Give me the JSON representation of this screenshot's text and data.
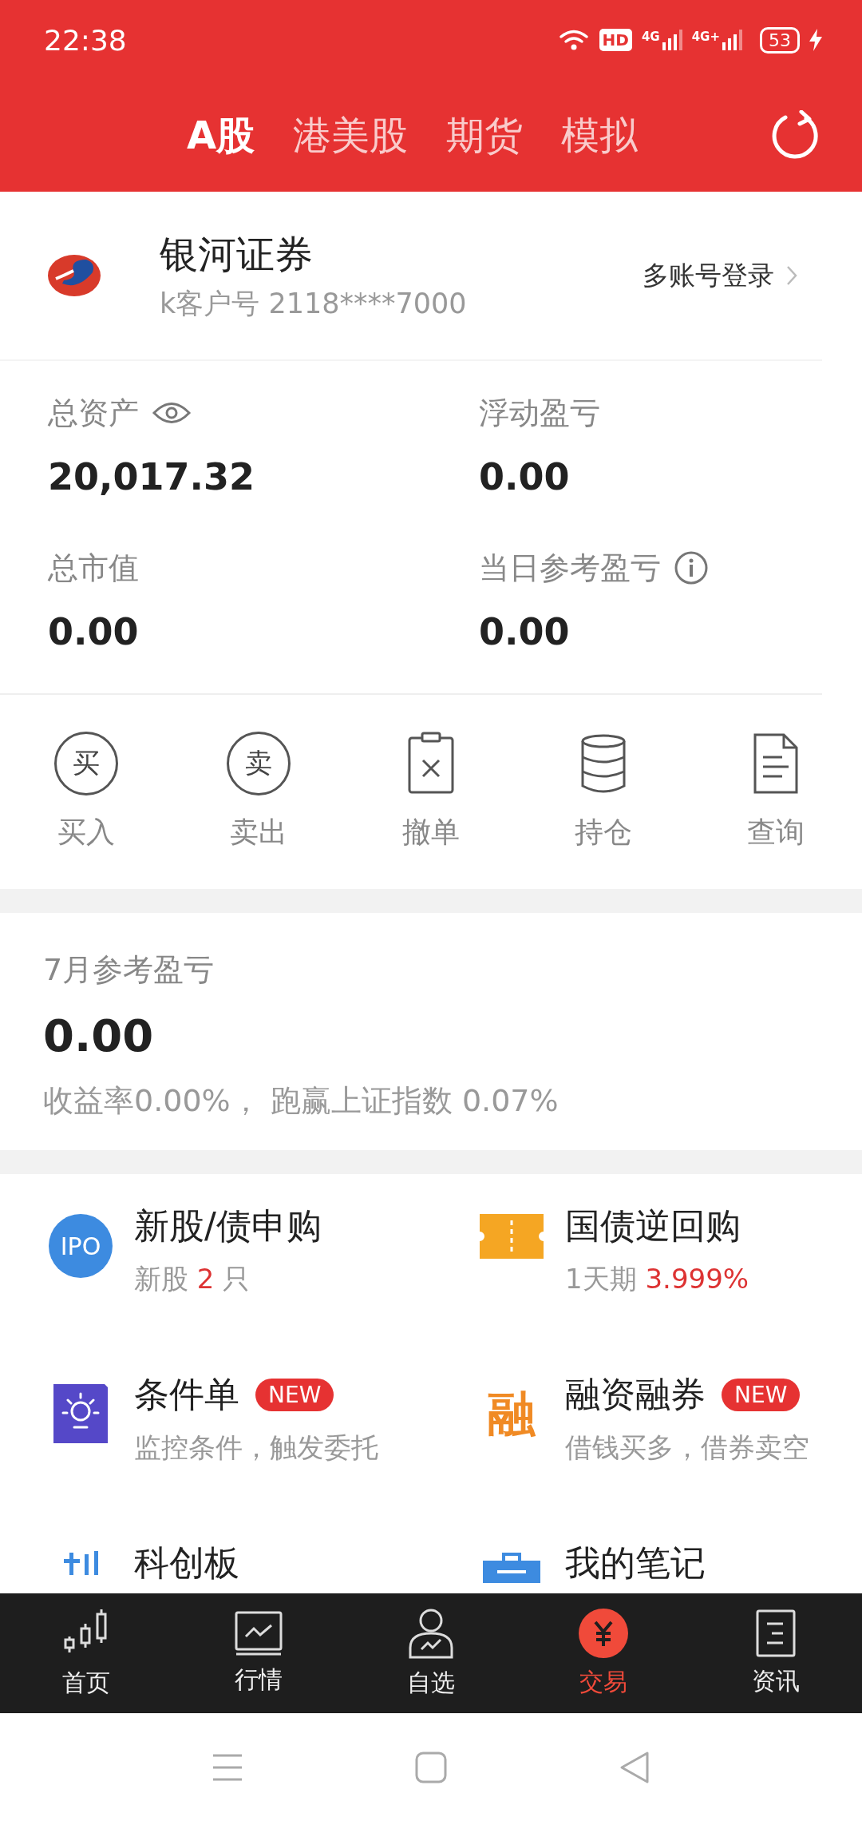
{
  "status_bar": {
    "time": "22:38",
    "hd": "HD",
    "networks": [
      "4G",
      "4G+"
    ],
    "battery": "53"
  },
  "tabs": [
    {
      "label": "A股",
      "selected": true
    },
    {
      "label": "港美股",
      "selected": false
    },
    {
      "label": "期货",
      "selected": false
    },
    {
      "label": "模拟",
      "selected": false
    }
  ],
  "account": {
    "broker": "银河证券",
    "customer_no": "k客户号 2118****7000",
    "multi_login": "多账号登录"
  },
  "assets": [
    {
      "label": "总资产",
      "value": "20,017.32",
      "kind": "eye"
    },
    {
      "label": "浮动盈亏",
      "value": "0.00",
      "kind": "plain"
    },
    {
      "label": "总市值",
      "value": "0.00",
      "kind": "plain"
    },
    {
      "label": "当日参考盈亏",
      "value": "0.00",
      "kind": "info"
    }
  ],
  "actions": [
    {
      "label": "买入",
      "glyph": "买"
    },
    {
      "label": "卖出",
      "glyph": "卖"
    },
    {
      "label": "撤单"
    },
    {
      "label": "持仓"
    },
    {
      "label": "查询"
    }
  ],
  "monthly": {
    "title": "7月参考盈亏",
    "value": "0.00",
    "summary": "收益率0.00%， 跑赢上证指数 0.07%"
  },
  "services": [
    {
      "title": "新股/债申购",
      "icon_text": "IPO",
      "subtitle": [
        {
          "text": "新股 ",
          "highlight": false
        },
        {
          "text": "2",
          "highlight": true
        },
        {
          "text": " 只",
          "highlight": false
        }
      ]
    },
    {
      "title": "国债逆回购",
      "subtitle": [
        {
          "text": "1天期 ",
          "highlight": false
        },
        {
          "text": "3.999%",
          "highlight": true
        }
      ]
    },
    {
      "title": "条件单",
      "badge": "NEW",
      "subtitle": [
        {
          "text": "监控条件，触发委托",
          "highlight": false
        }
      ]
    },
    {
      "title": "融资融券",
      "badge": "NEW",
      "icon_text": "融",
      "subtitle": [
        {
          "text": "借钱买多，借券卖空",
          "highlight": false
        }
      ]
    },
    {
      "title": "科创板"
    },
    {
      "title": "我的笔记"
    }
  ],
  "bottom_nav": [
    {
      "label": "首页",
      "selected": false
    },
    {
      "label": "行情",
      "selected": false
    },
    {
      "label": "自选",
      "selected": false
    },
    {
      "label": "交易",
      "selected": true
    },
    {
      "label": "资讯",
      "selected": false
    }
  ]
}
